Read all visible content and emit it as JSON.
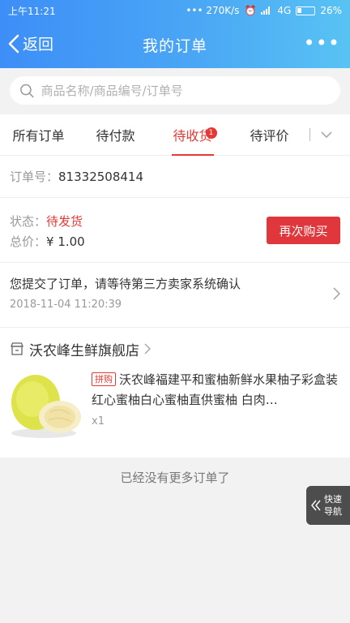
{
  "status_bar": {
    "time": "上午11:21",
    "indicators": "••• 270K/s",
    "network": "4G",
    "battery": "26%"
  },
  "nav": {
    "back_label": "返回",
    "title": "我的订单",
    "more_label": "•••"
  },
  "search": {
    "placeholder": "商品名称/商品编号/订单号"
  },
  "tabs": [
    {
      "label": "所有订单"
    },
    {
      "label": "待付款"
    },
    {
      "label": "待收货",
      "badge": "1",
      "active": true
    },
    {
      "label": "待评价"
    }
  ],
  "order": {
    "number_label": "订单号：",
    "number": "81332508414",
    "status_label": "状态：",
    "status": "待发货",
    "total_label": "总价：",
    "total": "¥ 1.00",
    "rebuy_label": "再次购买",
    "message": "您提交了订单，请等待第三方卖家系统确认",
    "timestamp": "2018-11-04 11:20:39"
  },
  "shop": {
    "name": "沃农峰生鲜旗舰店"
  },
  "item": {
    "tag": "拼购",
    "title": "沃农峰福建平和蜜柚新鲜水果柚子彩盒装 红心蜜柚白心蜜柚直供蜜柚 白肉…",
    "qty": "x1"
  },
  "footer": {
    "no_more": "已经没有更多订单了"
  },
  "quick_nav": {
    "label_line1": "快速",
    "label_line2": "导航"
  },
  "colors": {
    "header_gradient_start": "#3d8ef7",
    "header_gradient_end": "#58c3f3",
    "accent_red": "#e53935"
  }
}
